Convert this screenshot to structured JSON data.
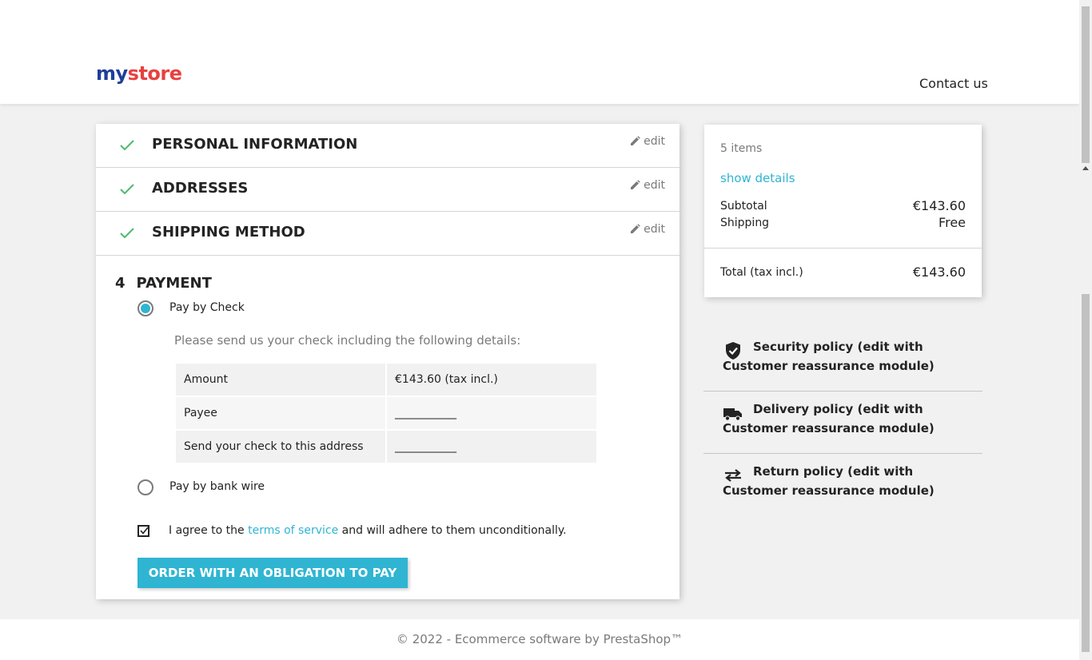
{
  "header": {
    "logo_parts": [
      "my",
      " ",
      "store"
    ],
    "contact_label": "Contact us"
  },
  "steps": [
    {
      "title": "Personal Information",
      "edit_label": "edit"
    },
    {
      "title": "Addresses",
      "edit_label": "edit"
    },
    {
      "title": "Shipping Method",
      "edit_label": "edit"
    }
  ],
  "payment": {
    "step_number": "4",
    "title": "PAYMENT",
    "option_check": "Pay by Check",
    "instructions": "Please send us your check including the following details:",
    "details": [
      {
        "label": "Amount",
        "value": "€143.60 (tax incl.)"
      },
      {
        "label": "Payee",
        "value": "___________"
      },
      {
        "label": "Send your check to this address",
        "value": "___________"
      }
    ],
    "option_wire": "Pay by bank wire",
    "agree_prefix": "I agree to the ",
    "agree_link": "terms of service",
    "agree_suffix": " and will adhere to them unconditionally.",
    "order_button": "Order with an obligation to pay",
    "selected_option": "Pay by Check",
    "terms_checked": true
  },
  "summary": {
    "items": "5 items",
    "show_details": "show details",
    "subtotal_label": "Subtotal",
    "subtotal_value": "€143.60",
    "shipping_label": "Shipping",
    "shipping_value": "Free",
    "total_label": "Total (tax incl.)",
    "total_value": "€143.60"
  },
  "reassurance": [
    {
      "icon": "shield-check-icon",
      "text": "Security policy (edit with Customer reassurance module)"
    },
    {
      "icon": "truck-icon",
      "text": "Delivery policy (edit with Customer reassurance module)"
    },
    {
      "icon": "swap-arrows-icon",
      "text": "Return policy (edit with Customer reassurance module)"
    }
  ],
  "footer": {
    "text": "© 2022 - Ecommerce software by PrestaShop™"
  },
  "colors": {
    "accent": "#2fb5d2",
    "check_green": "#4cbb6c",
    "background": "#f1f1f1"
  }
}
